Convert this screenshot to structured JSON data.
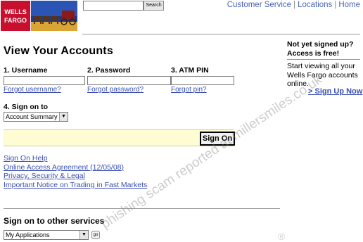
{
  "logo": {
    "line1": "WELLS",
    "line2": "FARGO"
  },
  "search": {
    "button_label": "Search",
    "value": ""
  },
  "topnav": {
    "items": [
      "Customer Service",
      "Locations",
      "Home"
    ],
    "separator": "|"
  },
  "main": {
    "title": "View Your Accounts",
    "username_label": "1. Username",
    "password_label": "2. Password",
    "atm_pin_label": "3. ATM PIN",
    "forgot_username": "Forgot username?",
    "forgot_password": "Forgot password?",
    "forgot_pin": "Forgot pin?",
    "sign_on_to_label": "4. Sign on to",
    "sign_on_to_selected": "Account Summary",
    "sign_on_button": "Sign On",
    "links": [
      "Sign On Help",
      "Online Access Agreement (12/05/08)",
      "Privacy, Security & Legal",
      "Important Notice on Trading in Fast Markets"
    ],
    "other_services_title": "Sign on to other services",
    "other_services_selected": "My Applications",
    "go_label": "go"
  },
  "sidebar": {
    "headline_1": "Not yet signed up?",
    "headline_2": "Access is free!",
    "text_1": "Start viewing all your",
    "text_2": "Wells Fargo accounts",
    "text_3": "online.",
    "signup_link": "> Sign Up Now"
  },
  "watermark": {
    "text": "phishing scam reported at millersmiles.co.uk",
    "mark": "®"
  },
  "colors": {
    "brand_red": "#c8102e",
    "link": "#3a4fb2",
    "signon_bar": "#fffbd3"
  }
}
